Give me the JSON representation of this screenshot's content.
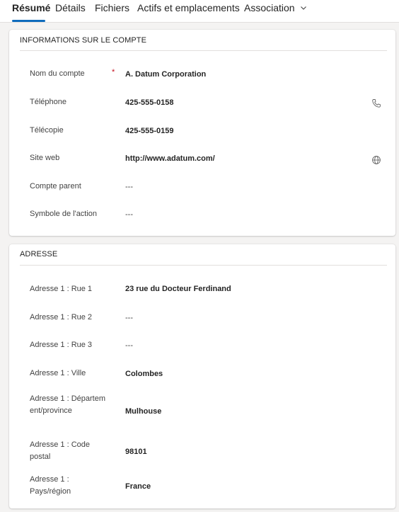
{
  "tabs": [
    {
      "label": "Résumé",
      "active": true
    },
    {
      "label": "Détails"
    },
    {
      "label": "Fichiers"
    },
    {
      "label": "Actifs et emplacements"
    },
    {
      "label": "Association"
    }
  ],
  "account_section": {
    "title": "INFORMATIONS SUR LE COMPTE",
    "required_marker": "*",
    "fields": [
      {
        "label": "Nom du compte",
        "value": "A. Datum Corporation"
      },
      {
        "label": "Téléphone",
        "value": "425-555-0158"
      },
      {
        "label": "Télécopie",
        "value": "425-555-0159"
      },
      {
        "label": "Site web",
        "value": "http://www.adatum.com/"
      },
      {
        "label": "Compte parent",
        "value": "---"
      },
      {
        "label": "Symbole de l'action",
        "value": "---"
      }
    ]
  },
  "address_section": {
    "title": "ADRESSE",
    "fields": [
      {
        "label": "Adresse 1 : Rue 1",
        "value": "23 rue du Docteur Ferdinand"
      },
      {
        "label": "Adresse 1 : Rue 2",
        "value": "---"
      },
      {
        "label": "Adresse 1 : Rue 3",
        "value": "---"
      },
      {
        "label": "Adresse 1 : Ville",
        "value": "Colombes"
      },
      {
        "label": "Adresse 1 : Département/province",
        "value": "Mulhouse"
      },
      {
        "label": "Adresse 1 : Code postal",
        "value": "98101"
      },
      {
        "label": "Adresse 1 : Pays/région",
        "value": "France"
      }
    ]
  },
  "icons": {
    "phone": "phone-icon",
    "web": "globe-icon",
    "dropdown": "chevron-down-icon"
  },
  "colors": {
    "accent": "#0f6cbd",
    "required": "#c50f1f",
    "background": "#f4f3f2"
  }
}
